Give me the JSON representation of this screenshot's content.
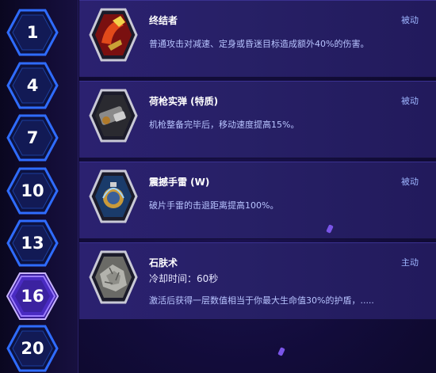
{
  "levels": [
    {
      "number": "1",
      "selected": false
    },
    {
      "number": "4",
      "selected": false
    },
    {
      "number": "7",
      "selected": false
    },
    {
      "number": "10",
      "selected": false
    },
    {
      "number": "13",
      "selected": false
    },
    {
      "number": "16",
      "selected": true
    },
    {
      "number": "20",
      "selected": false
    }
  ],
  "talents": [
    {
      "name": "终结者",
      "type": "被动",
      "description": "普通攻击对减速、定身或昏迷目标造成额外40%的伤害。",
      "icon": "claw-icon"
    },
    {
      "name": "荷枪实弹 (特质)",
      "type": "被动",
      "description": "机枪整备完毕后，移动速度提高15%。",
      "icon": "gun-icon"
    },
    {
      "name": "震撼手雷 (W)",
      "type": "被动",
      "description": "破片手雷的击退距离提高100%。",
      "icon": "grenade-icon"
    },
    {
      "name": "石肤术",
      "type": "主动",
      "cooldown": "冷却时间：60秒",
      "description": "激活后获得一层数值相当于你最大生命值30%的护盾，.....",
      "icon": "stoneskin-icon"
    }
  ],
  "colors": {
    "hex_border": "#2f6cff",
    "hex_selected": "#9b7bff",
    "row_bg": "#2b2170",
    "passive_text": "#9eb6ff"
  }
}
